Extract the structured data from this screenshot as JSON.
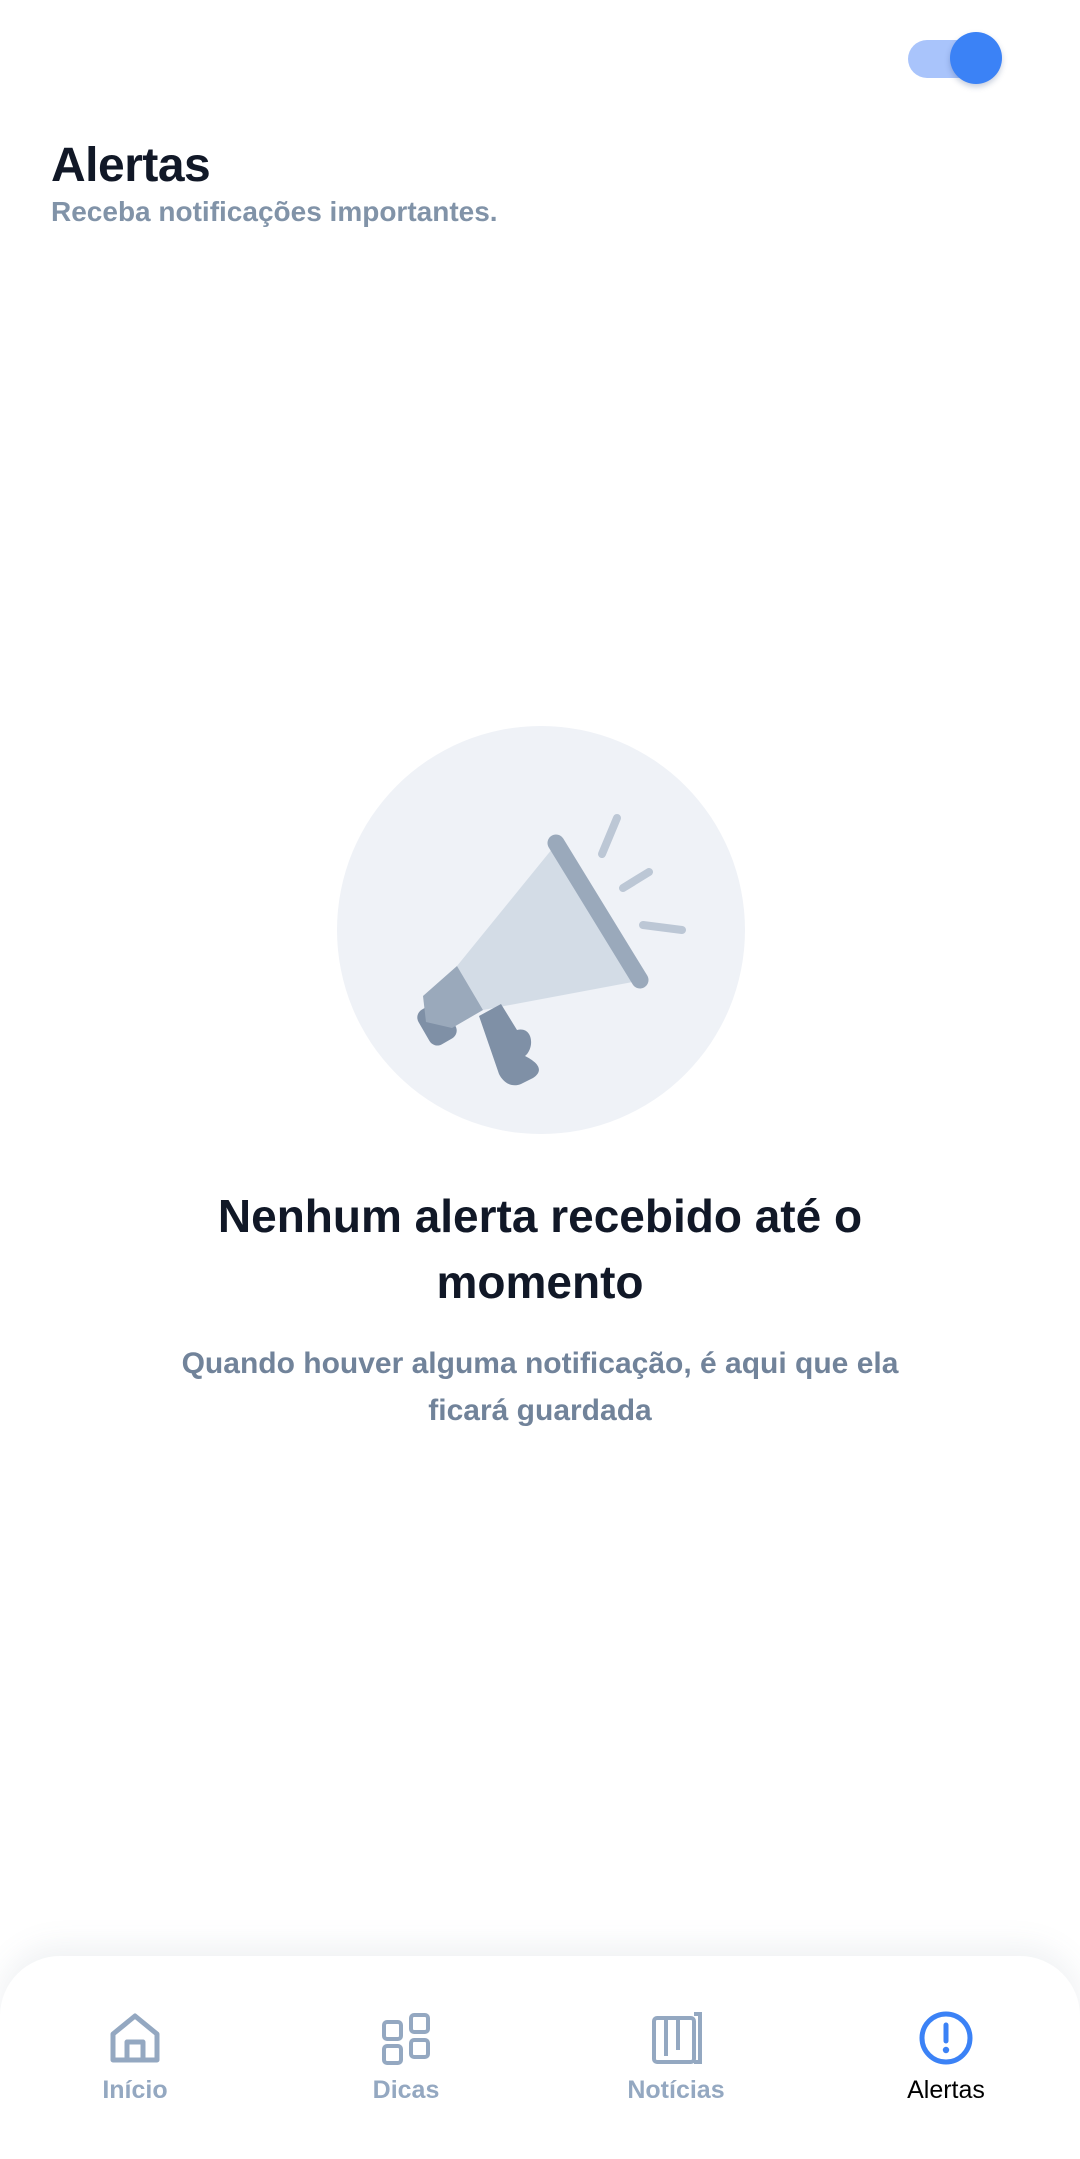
{
  "header": {
    "title": "Alertas",
    "subtitle": "Receba notificações importantes."
  },
  "toggle": {
    "state": "on",
    "accent_color": "#3b82f6",
    "track_color": "#a9c4fb"
  },
  "empty_state": {
    "icon": "megaphone-icon",
    "title": "Nenhum alerta recebido até o momento",
    "description": "Quando houver alguma notificação, é aqui que ela ficará guardada"
  },
  "bottom_nav": {
    "items": [
      {
        "label": "Início",
        "icon": "home-icon",
        "active": false
      },
      {
        "label": "Dicas",
        "icon": "grid-icon",
        "active": false
      },
      {
        "label": "Notícias",
        "icon": "news-icon",
        "active": false
      },
      {
        "label": "Alertas",
        "icon": "alert-circle-icon",
        "active": true
      }
    ],
    "active_color": "#3b82f6",
    "inactive_color": "#94a8c1"
  }
}
